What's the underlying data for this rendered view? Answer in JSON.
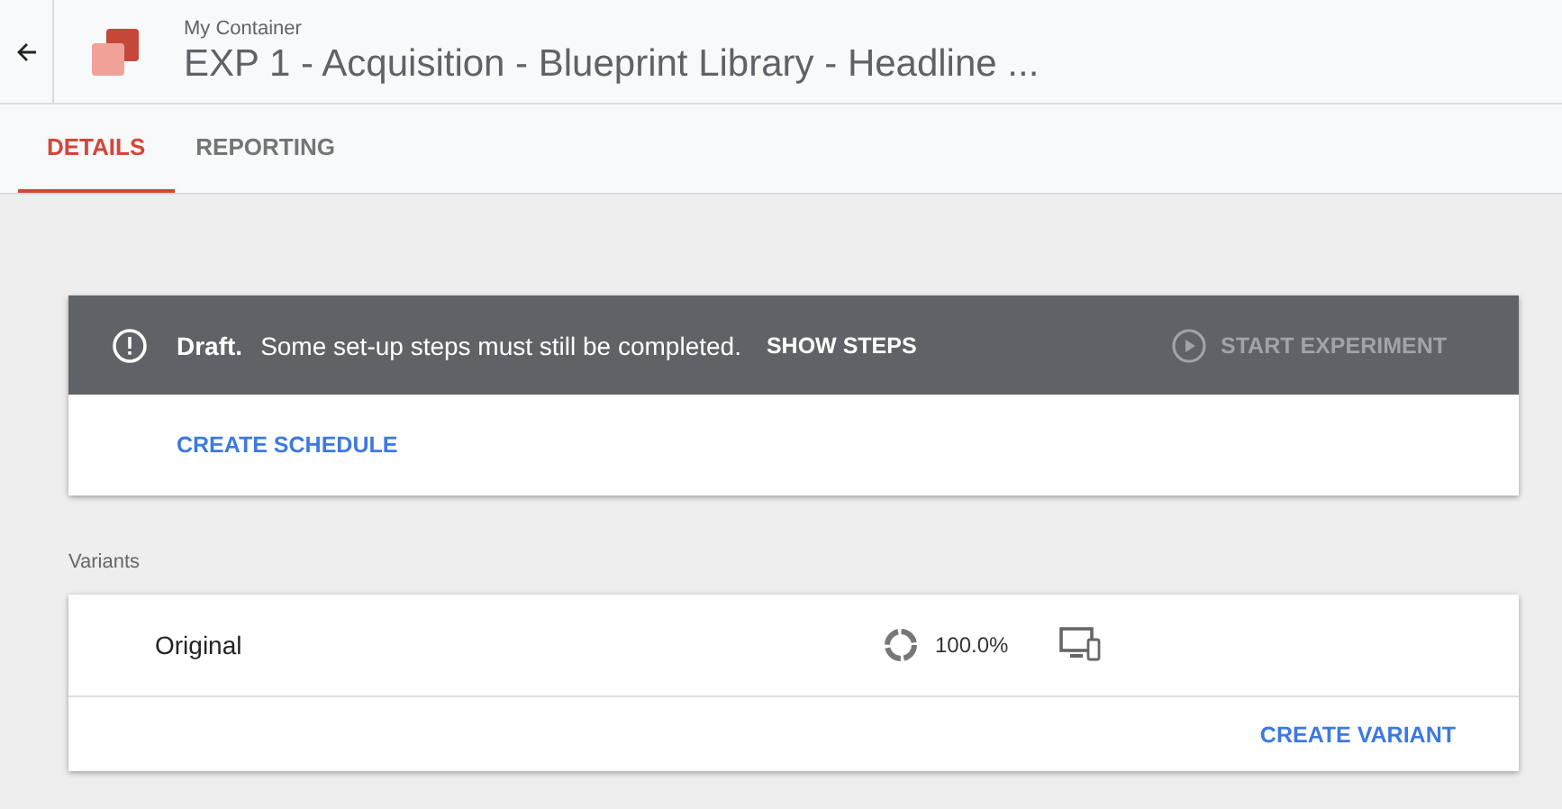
{
  "header": {
    "container": "My Container",
    "title": "EXP 1 - Acquisition - Blueprint Library - Headline ..."
  },
  "tabs": [
    {
      "label": "DETAILS",
      "selected": true
    },
    {
      "label": "REPORTING",
      "selected": false
    }
  ],
  "status_bar": {
    "status": "Draft.",
    "message": "Some set-up steps must still be completed.",
    "link": "SHOW STEPS",
    "action": {
      "label": "START EXPERIMENT",
      "disabled": true
    }
  },
  "schedule_link": "CREATE SCHEDULE",
  "variants": {
    "label": "Variants",
    "rows": [
      {
        "name": "Original",
        "share": "100.0%"
      }
    ],
    "create_link": "CREATE VARIANT"
  }
}
